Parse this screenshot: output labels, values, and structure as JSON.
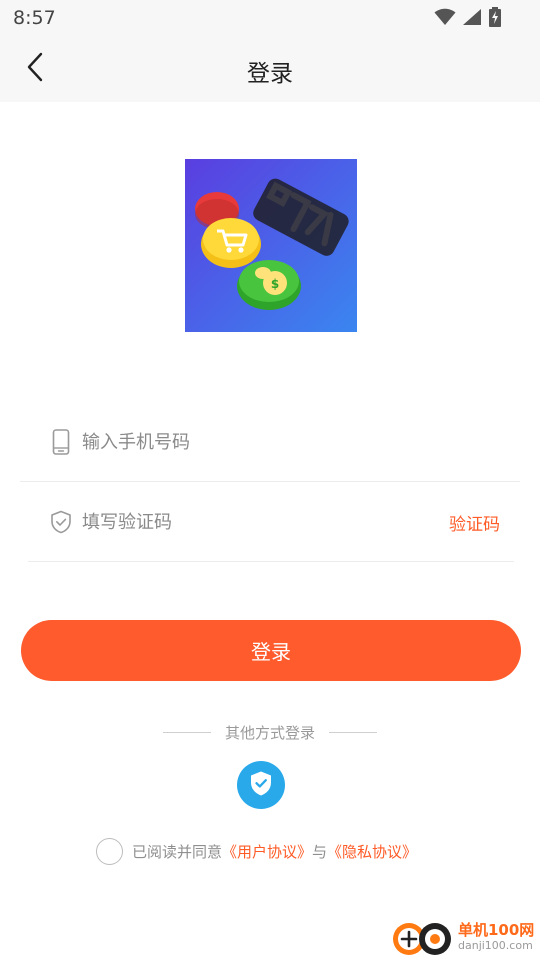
{
  "status_bar": {
    "time": "8:57",
    "icons": [
      "wifi-icon",
      "signal-icon",
      "battery-charging-icon"
    ]
  },
  "nav": {
    "back_icon": "chevron-left-icon",
    "title": "登录"
  },
  "logo": {
    "image_text": "必淘乐购"
  },
  "form": {
    "phone": {
      "icon": "phone-icon",
      "placeholder": "输入手机号码",
      "value": ""
    },
    "code": {
      "icon": "shield-check-icon",
      "placeholder": "填写验证码",
      "value": "",
      "get_code_label": "验证码"
    }
  },
  "login_button": "登录",
  "other_methods": {
    "label": "其他方式登录",
    "icon": "shield-check-icon"
  },
  "agreement": {
    "checked": false,
    "prefix": "已阅读并同意",
    "user_agreement": "《用户协议》",
    "conjunction": "与",
    "privacy_policy": "《隐私协议》"
  },
  "watermark": {
    "line1": "单机100网",
    "line2": "danji100.com"
  },
  "colors": {
    "accent": "#ff5b2c",
    "link": "#ff5b27",
    "shield_blue": "#29a9ea",
    "bar_bg": "#f7f7f7"
  }
}
